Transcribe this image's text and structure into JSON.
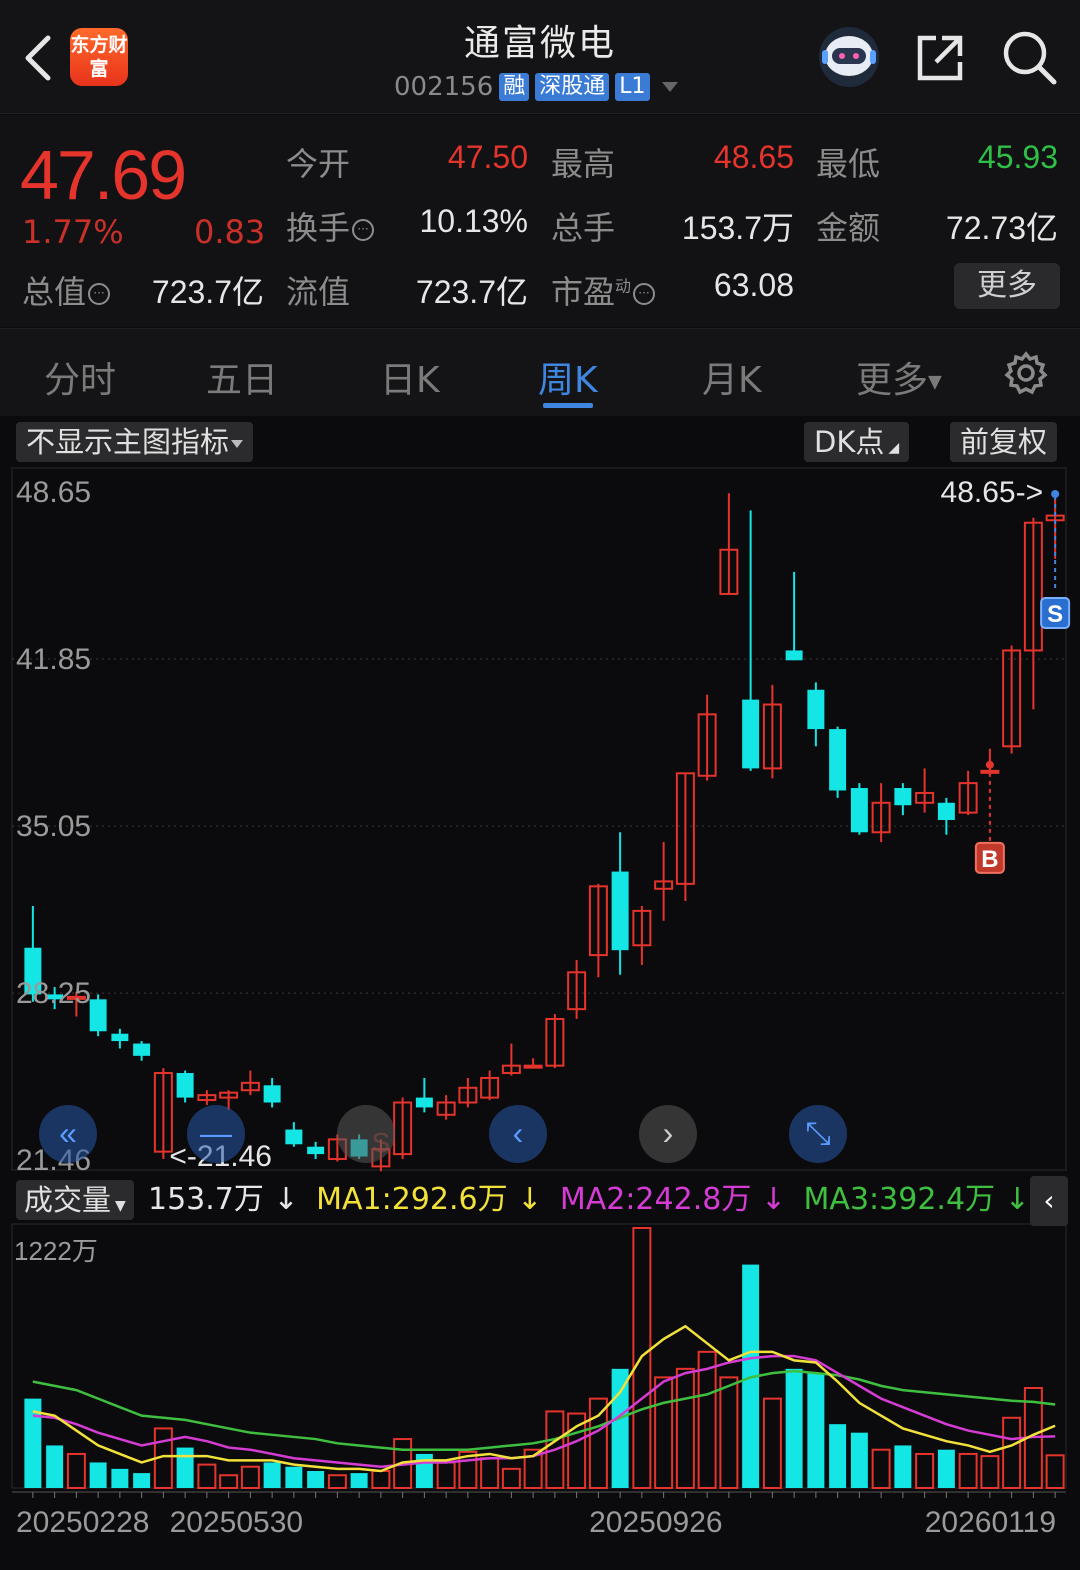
{
  "header": {
    "logo_text": "东方财富",
    "title": "通富微电",
    "code": "002156",
    "badges": [
      "融",
      "深股通",
      "L1"
    ]
  },
  "quote": {
    "price": "47.69",
    "change_pct": "1.77%",
    "change": "0.83",
    "open_label": "今开",
    "open": "47.50",
    "high_label": "最高",
    "high": "48.65",
    "low_label": "最低",
    "low": "45.93",
    "turnover_label": "换手",
    "turnover": "10.13%",
    "volume_label": "总手",
    "volume": "153.7万",
    "amount_label": "金额",
    "amount": "72.73亿",
    "mcap_label": "总值",
    "mcap": "723.7亿",
    "float_label": "流值",
    "float_mcap": "723.7亿",
    "pe_label": "市盈",
    "pe_sup": "动",
    "pe": "63.08",
    "more": "更多"
  },
  "tabs": [
    "分时",
    "五日",
    "日K",
    "周K",
    "月K",
    "更多"
  ],
  "active_tab": "周K",
  "chart": {
    "indicator_pill": "不显示主图指标",
    "dk_pill": "DK点",
    "adjust_pill": "前复权",
    "price_ticks": [
      "48.65",
      "41.85",
      "35.05",
      "28.25",
      "21.46"
    ],
    "max_marker": "48.65->",
    "min_marker": "<-21.46",
    "signal_b": "B",
    "signal_s": "S",
    "volume_label": "成交量",
    "vol_now": "153.7万 ↓",
    "ma1": "MA1:292.6万 ↓",
    "ma2": "MA2:242.8万 ↓",
    "ma3": "MA3:392.4万 ↓",
    "vol_max_tick": "1222万",
    "dates": [
      "20250228",
      "20250530",
      "20250926",
      "20260119"
    ],
    "colors": {
      "up": "#e5342c",
      "down": "#14e6e6",
      "ma1": "#f2e13a",
      "ma2": "#d43cd4",
      "ma3": "#3fbf3f"
    }
  },
  "chart_data": {
    "type": "candlestick",
    "ylim": [
      21.46,
      48.65
    ],
    "candles": [
      [
        30.1,
        28.2,
        31.8,
        27.9
      ],
      [
        28.2,
        28.0,
        28.5,
        27.6
      ],
      [
        28.1,
        28.1,
        28.3,
        27.3
      ],
      [
        28.0,
        26.7,
        28.2,
        26.5
      ],
      [
        26.6,
        26.3,
        26.8,
        26.0
      ],
      [
        26.2,
        25.7,
        26.3,
        25.5
      ],
      [
        21.8,
        25.0,
        25.2,
        21.5
      ],
      [
        25.0,
        24.0,
        25.1,
        23.8
      ],
      [
        23.9,
        24.1,
        24.3,
        23.7
      ],
      [
        24.0,
        24.2,
        24.3,
        23.5
      ],
      [
        24.3,
        24.6,
        25.1,
        24.1
      ],
      [
        24.5,
        23.8,
        24.8,
        23.6
      ],
      [
        22.7,
        22.1,
        23.0,
        22.0
      ],
      [
        22.0,
        21.7,
        22.2,
        21.5
      ],
      [
        21.5,
        22.3,
        22.5,
        21.4
      ],
      [
        22.3,
        21.6,
        22.5,
        21.5
      ],
      [
        21.2,
        21.9,
        22.3,
        21.0
      ],
      [
        21.7,
        23.8,
        24.0,
        21.5
      ],
      [
        24.0,
        23.6,
        24.8,
        23.4
      ],
      [
        23.3,
        23.8,
        24.1,
        23.1
      ],
      [
        23.8,
        24.4,
        24.8,
        23.6
      ],
      [
        24.0,
        24.8,
        25.1,
        23.9
      ],
      [
        25.0,
        25.3,
        26.2,
        24.9
      ],
      [
        25.3,
        25.3,
        25.6,
        25.2
      ],
      [
        25.3,
        27.2,
        27.4,
        25.2
      ],
      [
        27.6,
        29.1,
        29.6,
        27.2
      ],
      [
        29.8,
        32.6,
        32.7,
        28.9
      ],
      [
        33.2,
        30.0,
        34.8,
        29.0
      ],
      [
        30.2,
        31.6,
        31.8,
        29.4
      ],
      [
        32.5,
        32.8,
        34.4,
        31.2
      ],
      [
        32.7,
        37.2,
        37.2,
        32.0
      ],
      [
        37.1,
        39.6,
        40.4,
        36.9
      ],
      [
        44.5,
        46.3,
        48.6,
        44.5
      ],
      [
        40.2,
        37.4,
        47.9,
        37.3
      ],
      [
        37.4,
        40.0,
        40.8,
        37.0
      ],
      [
        42.2,
        41.8,
        45.4,
        41.8
      ],
      [
        40.6,
        39.0,
        40.9,
        38.3
      ],
      [
        39.0,
        36.5,
        39.1,
        36.2
      ],
      [
        36.6,
        34.8,
        36.8,
        34.7
      ],
      [
        34.8,
        36.0,
        36.8,
        34.4
      ],
      [
        36.6,
        35.9,
        36.8,
        35.5
      ],
      [
        36.0,
        36.4,
        37.4,
        35.6
      ],
      [
        36.0,
        35.3,
        36.2,
        34.7
      ],
      [
        35.6,
        36.8,
        37.3,
        35.5
      ],
      [
        37.3,
        37.3,
        38.2,
        37.2
      ],
      [
        38.3,
        42.2,
        42.4,
        38.0
      ],
      [
        42.2,
        47.4,
        47.6,
        39.8
      ],
      [
        47.5,
        47.69,
        48.65,
        45.93
      ]
    ],
    "volume_wan": [
      420,
      200,
      160,
      120,
      90,
      70,
      280,
      190,
      110,
      60,
      100,
      120,
      100,
      80,
      60,
      70,
      80,
      230,
      160,
      120,
      170,
      140,
      90,
      180,
      360,
      350,
      420,
      560,
      1222,
      520,
      560,
      640,
      520,
      1050,
      420,
      560,
      540,
      300,
      260,
      180,
      200,
      160,
      180,
      160,
      150,
      330,
      470,
      153.7
    ],
    "ma1_wan": [
      360,
      340,
      270,
      200,
      160,
      120,
      150,
      150,
      150,
      130,
      130,
      130,
      110,
      100,
      90,
      90,
      80,
      120,
      130,
      130,
      150,
      160,
      140,
      150,
      220,
      290,
      340,
      450,
      620,
      700,
      760,
      680,
      600,
      640,
      640,
      600,
      590,
      500,
      400,
      340,
      280,
      250,
      220,
      200,
      170,
      200,
      250,
      292.6
    ],
    "ma2_wan": [
      340,
      330,
      300,
      260,
      230,
      200,
      220,
      240,
      220,
      190,
      180,
      160,
      140,
      130,
      120,
      110,
      100,
      110,
      120,
      120,
      130,
      140,
      140,
      150,
      180,
      220,
      270,
      340,
      420,
      500,
      540,
      560,
      590,
      610,
      620,
      620,
      600,
      540,
      480,
      420,
      380,
      340,
      300,
      270,
      250,
      230,
      240,
      242.8
    ],
    "ma3_wan": [
      500,
      480,
      460,
      420,
      380,
      340,
      330,
      320,
      300,
      280,
      260,
      250,
      240,
      230,
      210,
      200,
      190,
      180,
      180,
      180,
      180,
      190,
      200,
      210,
      230,
      260,
      290,
      330,
      370,
      400,
      420,
      440,
      480,
      520,
      540,
      550,
      540,
      530,
      510,
      480,
      460,
      450,
      440,
      430,
      420,
      410,
      405,
      392.4
    ]
  }
}
